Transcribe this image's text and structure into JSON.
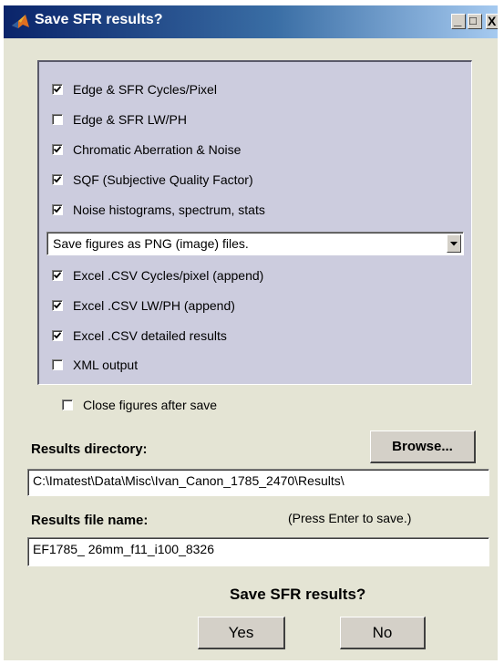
{
  "window": {
    "title": "Save SFR results?",
    "title_bar_color": "#0a246a",
    "icon": "matlab-icon"
  },
  "title_buttons": {
    "minimize": "_",
    "maximize": "□",
    "close": "X"
  },
  "options": [
    {
      "label": "Edge & SFR Cycles/Pixel",
      "checked": true
    },
    {
      "label": "Edge & SFR LW/PH",
      "checked": false
    },
    {
      "label": "Chromatic Aberration & Noise",
      "checked": true
    },
    {
      "label": "SQF (Subjective Quality Factor)",
      "checked": true
    },
    {
      "label": "Noise histograms, spectrum, stats",
      "checked": true
    }
  ],
  "figure_format": {
    "selected": "Save figures as PNG (image) files."
  },
  "excel_options": [
    {
      "label": "Excel .CSV Cycles/pixel (append)",
      "checked": true
    },
    {
      "label": "Excel .CSV LW/PH (append)",
      "checked": true
    },
    {
      "label": "Excel .CSV detailed results",
      "checked": true
    },
    {
      "label": "XML output",
      "checked": false
    }
  ],
  "close_figures": {
    "label": "Close figures after save",
    "checked": false
  },
  "results_directory": {
    "label": "Results directory:",
    "browse_label": "Browse...",
    "value": "C:\\Imatest\\Data\\Misc\\Ivan_Canon_1785_2470\\Results\\"
  },
  "results_file": {
    "label": "Results file name:",
    "hint": "(Press Enter to save.)",
    "value": "EF1785_ 26mm_f11_i100_8326"
  },
  "prompt": "Save SFR results?",
  "yes_label": "Yes",
  "no_label": "No",
  "colors": {
    "dialog_bg": "#e4e4d4",
    "panel_bg": "#ccccde"
  }
}
